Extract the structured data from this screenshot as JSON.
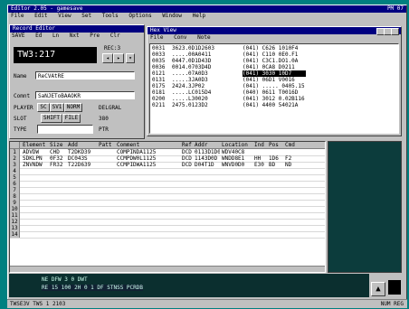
{
  "app": {
    "title": "Editor 2.05 - gamesave",
    "clock": "PM 07",
    "menu": [
      "File",
      "Edit",
      "View",
      "Set",
      "Tools",
      "Options",
      "Window",
      "Help"
    ]
  },
  "editor_window": {
    "title": "Record Editor",
    "menu": [
      "SAVE",
      "Ed",
      "Ln",
      "Nxt",
      "Pre",
      "Clr"
    ],
    "display_value": "TW3:217",
    "counter_label": "REC:3",
    "fields": {
      "name_label": "Name",
      "name_value": "ReCVAtRE",
      "comment_label": "Comnt",
      "comment_value": "SaNJEToBAAOKR",
      "player_label": "PLAYER",
      "slot_label": "SLOT",
      "type_label": "TYPE",
      "tags": [
        "SC",
        "SV1",
        "NORM",
        "SHIFT",
        "FILE"
      ],
      "right_labels": [
        "DELGRAL",
        "380",
        "PTR"
      ]
    }
  },
  "hex_window": {
    "title": "Hex View",
    "menu": [
      "File",
      "Conv",
      "Note"
    ],
    "rows": [
      {
        "addr": "0031",
        "hex": "3623.0D1D2603",
        "info": "(041) C626 1010F4"
      },
      {
        "addr": "0033",
        "hex": ".....00A0411",
        "info": "(041) C110 0E0.F1"
      },
      {
        "addr": "0035",
        "hex": "0447.0D1D43D",
        "info": "(041) C3C1.DO1.0A"
      },
      {
        "addr": "0036",
        "hex": "0014.0703D4D",
        "info": "(041) 0CA8 D0211"
      },
      {
        "addr": "0121",
        "hex": ".....07A0D3",
        "info": "(041) 3030 10D7"
      },
      {
        "addr": "0131",
        "hex": ".....3JA0D3",
        "info": "(041) 06D1 V0016"
      },
      {
        "addr": "0175",
        "hex": "2424.3JP02",
        "info": "(041) ..... 0405.15"
      },
      {
        "addr": "0181",
        "hex": ".....LC015D4",
        "info": "(040) 0611 T0016D"
      },
      {
        "addr": "0200",
        "hex": ".....L30020",
        "info": "(041) 3012 0.02B116"
      },
      {
        "addr": "0211",
        "hex": "2475.0123D2",
        "info": "(041) 4400 54021A"
      }
    ]
  },
  "grid": {
    "headers": [
      "Element",
      "Size",
      "Add",
      "Patt",
      "Comment",
      "Ref",
      "Addr",
      "Location",
      "Ind",
      "Pos",
      "Cmd"
    ],
    "rows": [
      [
        "ADVDW",
        "CHD",
        "T2DKD39",
        "",
        "COMPINDA1125",
        "DCD",
        "0113D1D0",
        "WDV40C8",
        "",
        "",
        ""
      ],
      [
        "SDKLPN",
        "0F32",
        "DC043S",
        "",
        "CCMPDW0L1125",
        "DCD",
        "1143D0D",
        "WNDD8E1",
        "HH",
        "1D6",
        "F2"
      ],
      [
        "ZNVNDW",
        "FR32",
        "T22D639",
        "",
        "CCMPIDWA1125",
        "DCD",
        "D04T1D",
        "WNVD0D0",
        "E30",
        "BD",
        "ND"
      ]
    ],
    "row_numbers": [
      "1",
      "2",
      "3",
      "4",
      "5",
      "6",
      "7",
      "8",
      "9",
      "10",
      "11",
      "12",
      "13",
      "14"
    ]
  },
  "output": {
    "line1": "NE DFW 3 0 DWT",
    "line2": "RE 15 100 2H 0 1 DF STNSS PCRDB"
  },
  "statusbar": {
    "left": "TWSE3V TWS 1 2103",
    "right": "NUM  REG"
  },
  "colors": {
    "desktop": "#008080",
    "titlebar": "#000080",
    "display": "#000000",
    "highlight": "#000080"
  }
}
